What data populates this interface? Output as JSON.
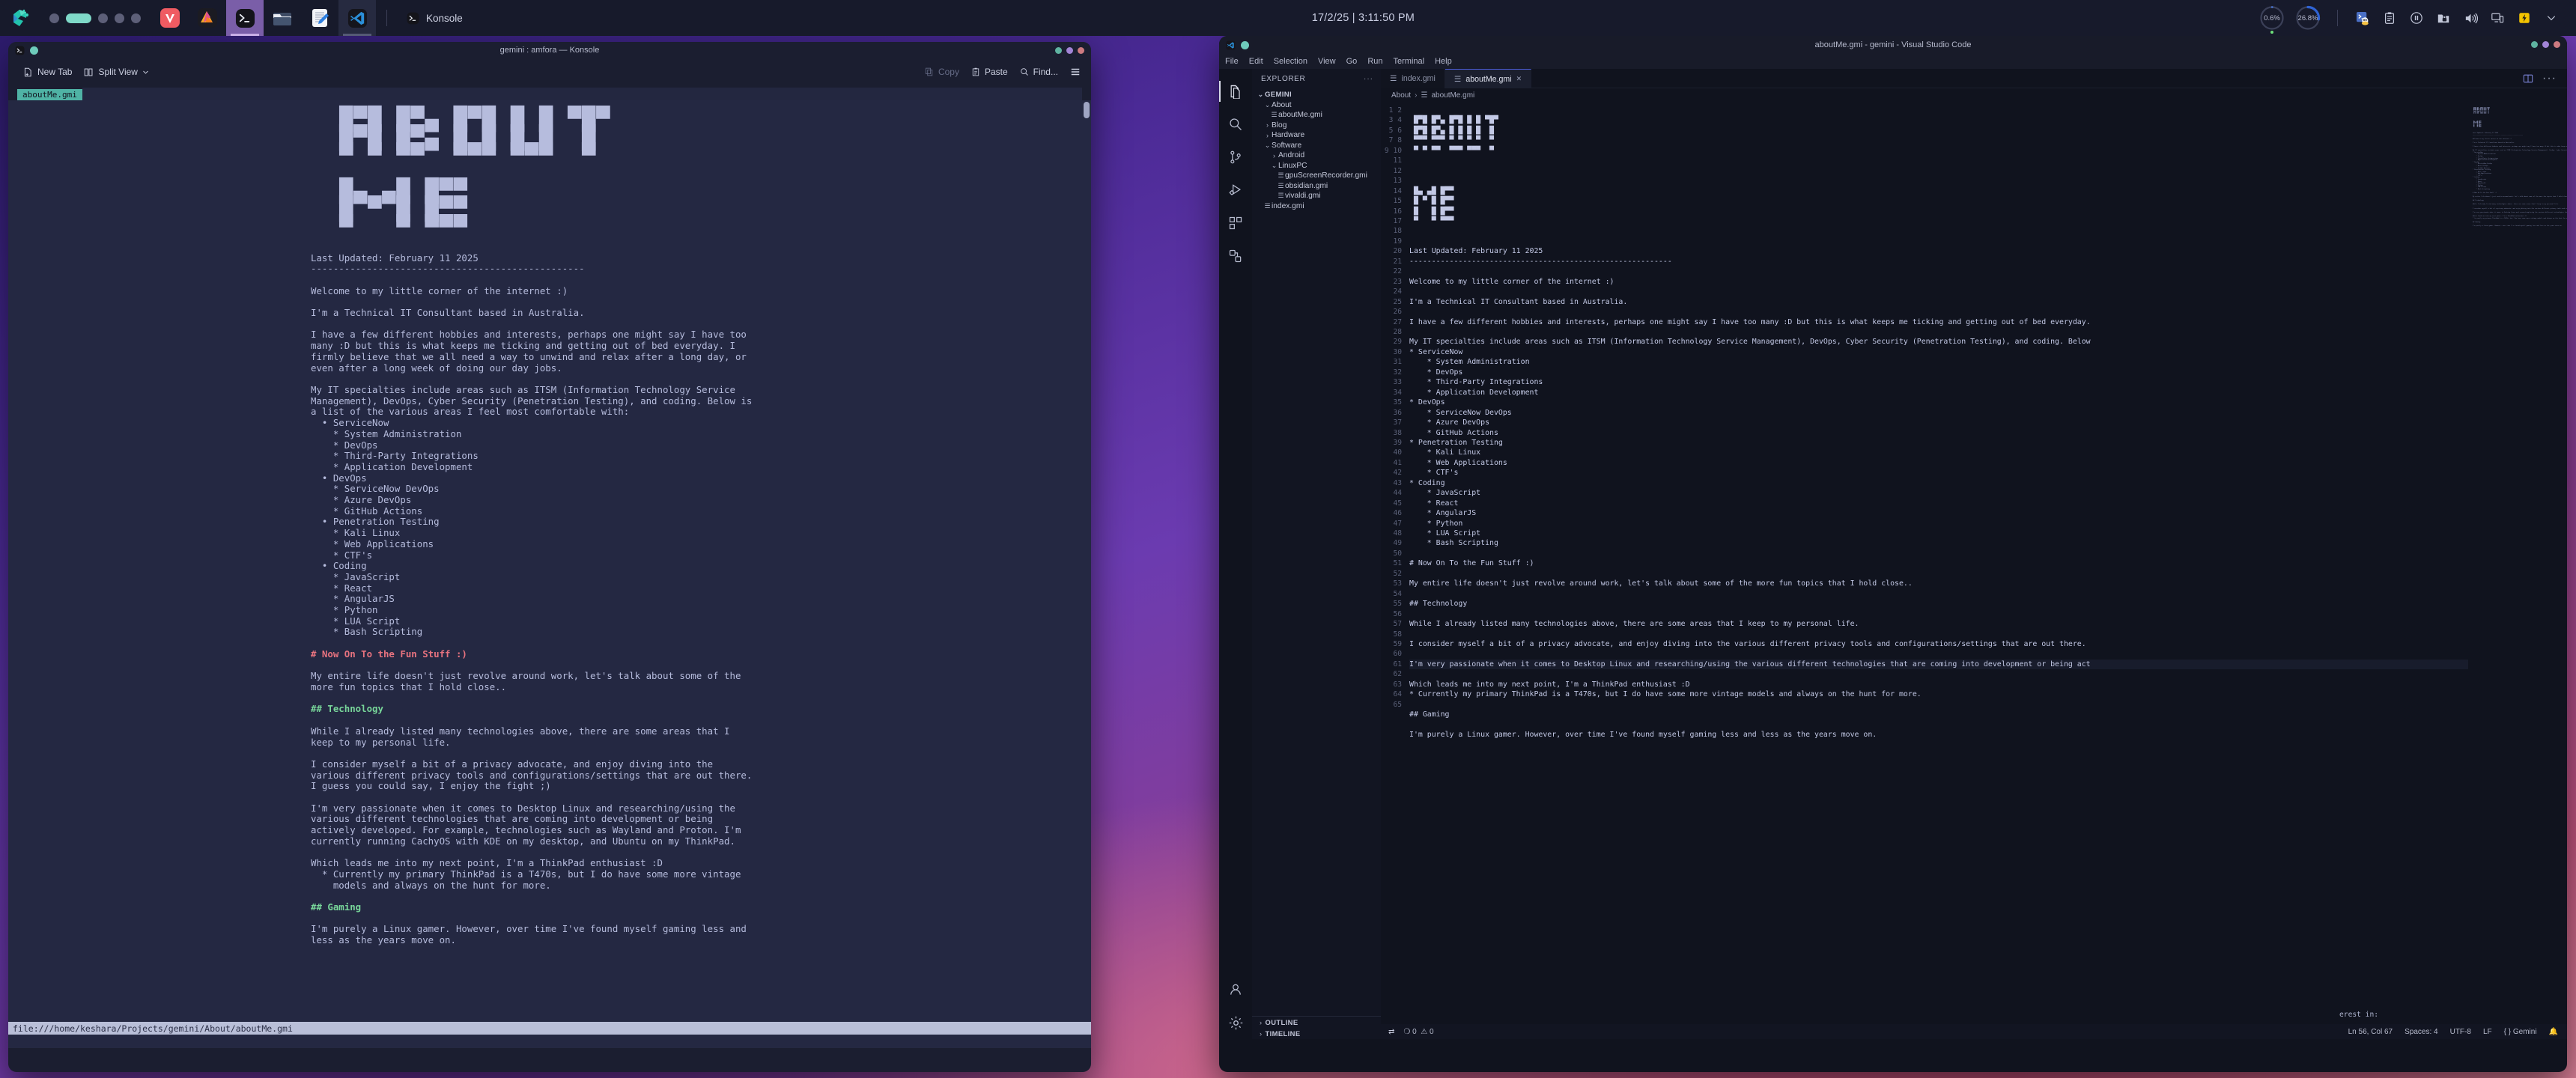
{
  "taskbar": {
    "launcher_icon": "app-launcher-icon",
    "pager_count": 5,
    "pager_active_index": 1,
    "apps": [
      {
        "name": "vivaldi",
        "icon": "vivaldi-icon",
        "state": "idle"
      },
      {
        "name": "affinity",
        "icon": "affinity-icon",
        "state": "idle"
      },
      {
        "name": "konsole",
        "icon": "konsole-icon",
        "state": "active"
      },
      {
        "name": "dolphin",
        "icon": "folder-icon",
        "state": "idle"
      },
      {
        "name": "text-editor",
        "icon": "notepad-icon",
        "state": "idle"
      },
      {
        "name": "vscode",
        "icon": "vscode-icon",
        "state": "open"
      }
    ],
    "task_label": "Konsole",
    "clock": "17/2/25 | 3:11:50 PM",
    "gauges": [
      {
        "name": "cpu-gauge",
        "value": "0.6%",
        "percent": 0.6,
        "color": "#4a78d8"
      },
      {
        "name": "memory-gauge",
        "value": "26.8%",
        "percent": 26.8,
        "color": "#2f63d4"
      }
    ],
    "tray": [
      "tux-terminal-icon",
      "clipboard-icon",
      "pause-icon",
      "lock-folder-icon",
      "volume-icon",
      "display-icon",
      "battery-icon",
      "chevron-down-icon"
    ]
  },
  "konsole": {
    "title": "gemini : amfora — Konsole",
    "toolbar": {
      "new_tab": "New Tab",
      "split_view": "Split View",
      "copy": "Copy",
      "paste": "Paste",
      "find": "Find...",
      "menu_icon": "hamburger-menu-icon"
    },
    "tab_label": "aboutMe.gmi",
    "status_url": "file:///home/keshara/Projects/gemini/About/aboutMe.gmi",
    "ascii_about": "  █▀█ █▀▄ █▀█ █ █ ▀█▀\n  █▀█ █▀▄ █ █ █ █  █ \n  ▀ ▀ ▀▀  ▀▀▀ ▀▀▀  ▀ ",
    "ascii_me": "  █▄ ▄█ █▀▀\n  █ ▀ █ █▀▀\n  ▀   ▀ ▀▀▀",
    "body": [
      {
        "t": "p",
        "x": "Last Updated: February 11 2025"
      },
      {
        "t": "p",
        "x": "-------------------------------------------------"
      },
      {
        "t": "blank",
        "x": ""
      },
      {
        "t": "p",
        "x": "Welcome to my little corner of the internet :)"
      },
      {
        "t": "blank",
        "x": ""
      },
      {
        "t": "p",
        "x": "I'm a Technical IT Consultant based in Australia."
      },
      {
        "t": "blank",
        "x": ""
      },
      {
        "t": "p",
        "x": "I have a few different hobbies and interests, perhaps one might say I have too"
      },
      {
        "t": "p",
        "x": "many :D but this is what keeps me ticking and getting out of bed everyday. I"
      },
      {
        "t": "p",
        "x": "firmly believe that we all need a way to unwind and relax after a long day, or"
      },
      {
        "t": "p",
        "x": "even after a long week of doing our day jobs."
      },
      {
        "t": "blank",
        "x": ""
      },
      {
        "t": "p",
        "x": "My IT specialties include areas such as ITSM (Information Technology Service"
      },
      {
        "t": "p",
        "x": "Management), DevOps, Cyber Security (Penetration Testing), and coding. Below is"
      },
      {
        "t": "p",
        "x": "a list of the various areas I feel most comfortable with:"
      },
      {
        "t": "p",
        "x": "  • ServiceNow"
      },
      {
        "t": "p",
        "x": "    * System Administration"
      },
      {
        "t": "p",
        "x": "    * DevOps"
      },
      {
        "t": "p",
        "x": "    * Third-Party Integrations"
      },
      {
        "t": "p",
        "x": "    * Application Development"
      },
      {
        "t": "p",
        "x": "  • DevOps"
      },
      {
        "t": "p",
        "x": "    * ServiceNow DevOps"
      },
      {
        "t": "p",
        "x": "    * Azure DevOps"
      },
      {
        "t": "p",
        "x": "    * GitHub Actions"
      },
      {
        "t": "p",
        "x": "  • Penetration Testing"
      },
      {
        "t": "p",
        "x": "    * Kali Linux"
      },
      {
        "t": "p",
        "x": "    * Web Applications"
      },
      {
        "t": "p",
        "x": "    * CTF's"
      },
      {
        "t": "p",
        "x": "  • Coding"
      },
      {
        "t": "p",
        "x": "    * JavaScript"
      },
      {
        "t": "p",
        "x": "    * React"
      },
      {
        "t": "p",
        "x": "    * AngularJS"
      },
      {
        "t": "p",
        "x": "    * Python"
      },
      {
        "t": "p",
        "x": "    * LUA Script"
      },
      {
        "t": "p",
        "x": "    * Bash Scripting"
      },
      {
        "t": "blank",
        "x": ""
      },
      {
        "t": "h1",
        "x": "# Now On To the Fun Stuff :)"
      },
      {
        "t": "blank",
        "x": ""
      },
      {
        "t": "p",
        "x": "My entire life doesn't just revolve around work, let's talk about some of the"
      },
      {
        "t": "p",
        "x": "more fun topics that I hold close.."
      },
      {
        "t": "blank",
        "x": ""
      },
      {
        "t": "h2",
        "x": "## Technology"
      },
      {
        "t": "blank",
        "x": ""
      },
      {
        "t": "p",
        "x": "While I already listed many technologies above, there are some areas that I"
      },
      {
        "t": "p",
        "x": "keep to my personal life."
      },
      {
        "t": "blank",
        "x": ""
      },
      {
        "t": "p",
        "x": "I consider myself a bit of a privacy advocate, and enjoy diving into the"
      },
      {
        "t": "p",
        "x": "various different privacy tools and configurations/settings that are out there."
      },
      {
        "t": "p",
        "x": "I guess you could say, I enjoy the fight ;)"
      },
      {
        "t": "blank",
        "x": ""
      },
      {
        "t": "p",
        "x": "I'm very passionate when it comes to Desktop Linux and researching/using the"
      },
      {
        "t": "p",
        "x": "various different technologies that are coming into development or being"
      },
      {
        "t": "p",
        "x": "actively developed. For example, technologies such as Wayland and Proton. I'm"
      },
      {
        "t": "p",
        "x": "currently running CachyOS with KDE on my desktop, and Ubuntu on my ThinkPad."
      },
      {
        "t": "blank",
        "x": ""
      },
      {
        "t": "p",
        "x": "Which leads me into my next point, I'm a ThinkPad enthusiast :D"
      },
      {
        "t": "p",
        "x": "  * Currently my primary ThinkPad is a T470s, but I do have some more vintage"
      },
      {
        "t": "p",
        "x": "    models and always on the hunt for more."
      },
      {
        "t": "blank",
        "x": ""
      },
      {
        "t": "h2",
        "x": "## Gaming"
      },
      {
        "t": "blank",
        "x": ""
      },
      {
        "t": "p",
        "x": "I'm purely a Linux gamer. However, over time I've found myself gaming less and"
      },
      {
        "t": "p",
        "x": "less as the years move on."
      }
    ]
  },
  "vscode": {
    "title": "aboutMe.gmi - gemini - Visual Studio Code",
    "menu": [
      "File",
      "Edit",
      "Selection",
      "View",
      "Go",
      "Run",
      "Terminal",
      "Help"
    ],
    "activitybar": [
      "explorer-icon",
      "search-icon",
      "source-control-icon",
      "run-debug-icon",
      "extensions-icon",
      "remote-explorer-icon",
      "account-icon",
      "settings-gear-icon"
    ],
    "sidebar": {
      "header": "EXPLORER",
      "more_icon": "more-actions-icon",
      "root": "GEMINI",
      "tree": [
        {
          "label": "About",
          "depth": 1,
          "kind": "folder",
          "open": true
        },
        {
          "label": "aboutMe.gmi",
          "depth": 2,
          "kind": "file"
        },
        {
          "label": "Blog",
          "depth": 1,
          "kind": "folder",
          "open": false
        },
        {
          "label": "Hardware",
          "depth": 1,
          "kind": "folder",
          "open": false
        },
        {
          "label": "Software",
          "depth": 1,
          "kind": "folder",
          "open": true
        },
        {
          "label": "Android",
          "depth": 2,
          "kind": "folder",
          "open": false
        },
        {
          "label": "LinuxPC",
          "depth": 2,
          "kind": "folder",
          "open": true
        },
        {
          "label": "gpuScreenRecorder.gmi",
          "depth": 3,
          "kind": "file"
        },
        {
          "label": "obsidian.gmi",
          "depth": 3,
          "kind": "file"
        },
        {
          "label": "vivaldi.gmi",
          "depth": 3,
          "kind": "file"
        },
        {
          "label": "index.gmi",
          "depth": 1,
          "kind": "file"
        }
      ],
      "sections": [
        "OUTLINE",
        "TIMELINE"
      ]
    },
    "tabs": [
      {
        "label": "index.gmi",
        "active": false,
        "close": ""
      },
      {
        "label": "aboutMe.gmi",
        "active": true,
        "close": "✕"
      }
    ],
    "tab_actions": [
      "split-editor-icon",
      "more-actions-icon"
    ],
    "breadcrumb": [
      "About",
      "aboutMe.gmi"
    ],
    "first_line": 1,
    "cursor_line": 56,
    "lines": [
      "",
      " █▀█ █▀▄ █▀█ █ █ ▀█▀",
      " █▀█ █▀▄ █ █ █ █  █ ",
      " ▀▀▀ ▀▀▀ ▀ ▀ ▀ ▀  ▀ ",
      " ▀ ▀ ▀▀  ▀▀▀ ▀▀▀  ▀ ",
      "",
      "",
      "",
      " █▄ ▄█ █▀▀",
      " █ ▀ █ █▀▀",
      " █   █ █▀▀",
      " ▀   ▀ ▀▀▀",
      "",
      "",
      "Last Updated: February 11 2025",
      "-----------------------------------------------------------",
      "",
      "Welcome to my little corner of the internet :)",
      "",
      "I'm a Technical IT Consultant based in Australia.",
      "",
      "I have a few different hobbies and interests, perhaps one might say I have too many :D but this is what keeps me ticking and getting out of bed everyday.",
      "",
      "My IT specialties include areas such as ITSM (Information Technology Service Management), DevOps, Cyber Security (Penetration Testing), and coding. Below",
      "* ServiceNow",
      "    * System Administration",
      "    * DevOps",
      "    * Third-Party Integrations",
      "    * Application Development",
      "* DevOps",
      "    * ServiceNow DevOps",
      "    * Azure DevOps",
      "    * GitHub Actions",
      "* Penetration Testing",
      "    * Kali Linux",
      "    * Web Applications",
      "    * CTF's",
      "* Coding",
      "    * JavaScript",
      "    * React",
      "    * AngularJS",
      "    * Python",
      "    * LUA Script",
      "    * Bash Scripting",
      "",
      "# Now On To the Fun Stuff :)",
      "",
      "My entire life doesn't just revolve around work, let's talk about some of the more fun topics that I hold close..",
      "",
      "## Technology",
      "",
      "While I already listed many technologies above, there are some areas that I keep to my personal life.",
      "",
      "I consider myself a bit of a privacy advocate, and enjoy diving into the various different privacy tools and configurations/settings that are out there.",
      "",
      "I'm very passionate when it comes to Desktop Linux and researching/using the various different technologies that are coming into development or being act",
      "",
      "Which leads me into my next point, I'm a ThinkPad enthusiast :D",
      "* Currently my primary ThinkPad is a T470s, but I do have some more vintage models and always on the hunt for more.",
      "",
      "## Gaming",
      "",
      "I'm purely a Linux gamer. However, over time I've found myself gaming less and less as the years move on.",
      "",
      ""
    ],
    "overflow_hint": "erest in:",
    "statusbar": {
      "remote_icon": "remote-window-icon",
      "errors": "0",
      "warnings": "0",
      "position": "Ln 56, Col 67",
      "indent": "Spaces: 4",
      "encoding": "UTF-8",
      "eol": "LF",
      "language": "Gemini",
      "bell_icon": "notifications-bell-icon"
    }
  },
  "colors": {
    "accent": "#4b5bd6",
    "terminal_bg": "#242842",
    "terminal_fg": "#b6bcdd",
    "h1": "#e8737f",
    "h2": "#78d69a",
    "tab_active": "#4fb3a5",
    "vscode_bg": "#10131e"
  }
}
